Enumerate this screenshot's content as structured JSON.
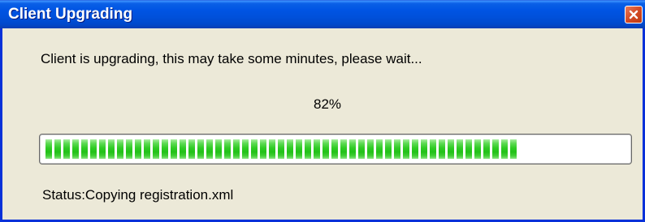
{
  "window": {
    "title": "Client Upgrading",
    "close_icon": "close-icon"
  },
  "content": {
    "message": "Client is upgrading, this may take some minutes, please wait...",
    "percent_label": "82%",
    "progress": 0.82,
    "status": "Status:Copying registration.xml"
  },
  "colors": {
    "titlebar": "#0054E3",
    "window_border": "#0831D9",
    "dialog_background": "#ECE9D8",
    "progress_green": "#2FCB24",
    "close_button": "#D44A24"
  }
}
